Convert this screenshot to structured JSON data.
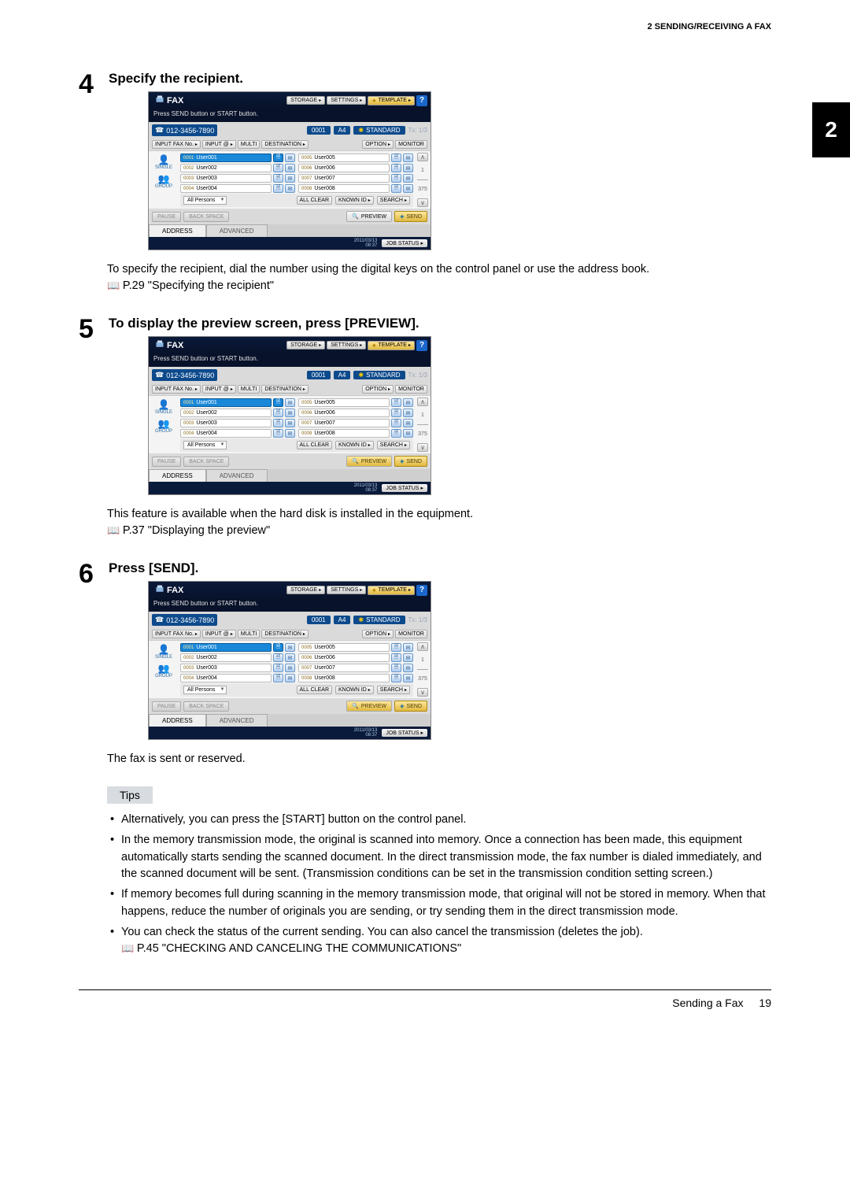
{
  "header": {
    "section": "2 SENDING/RECEIVING A FAX"
  },
  "chapter_tab": "2",
  "steps": {
    "s4": {
      "num": "4",
      "title": "Specify the recipient.",
      "body": "To specify the recipient, dial the number using the digital keys on the control panel or use the address book.",
      "ref": "P.29 \"Specifying the recipient\""
    },
    "s5": {
      "num": "5",
      "title": "To display the preview screen, press [PREVIEW].",
      "body": "This feature is available when the hard disk is installed in the equipment.",
      "ref": "P.37 \"Displaying the preview\""
    },
    "s6": {
      "num": "6",
      "title": "Press [SEND].",
      "body": "The fax is sent or reserved."
    }
  },
  "fax_panel": {
    "title": "FAX",
    "topbar": {
      "storage": "STORAGE",
      "settings": "SETTINGS",
      "template": "TEMPLATE",
      "help": "?"
    },
    "instruction": "Press SEND button or START button.",
    "status": {
      "fax_number": "012-3456-7890",
      "counter": "0001",
      "paper": "A4",
      "mode": "STANDARD",
      "tx_faded": "Tx: 1/3"
    },
    "row2": {
      "input_fax": "INPUT FAX No.",
      "input_at": "INPUT @",
      "multi": "MULTI",
      "destination": "DESTINATION",
      "option": "OPTION",
      "monitor": "MONITOR"
    },
    "sidebar": {
      "single": "SINGLE",
      "group": "GROUP"
    },
    "contacts_left": [
      {
        "id": "0001",
        "name": "User001"
      },
      {
        "id": "0002",
        "name": "User002"
      },
      {
        "id": "0003",
        "name": "User003"
      },
      {
        "id": "0004",
        "name": "User004"
      }
    ],
    "contacts_right": [
      {
        "id": "0005",
        "name": "User005"
      },
      {
        "id": "0006",
        "name": "User006"
      },
      {
        "id": "0007",
        "name": "User007"
      },
      {
        "id": "0008",
        "name": "User008"
      }
    ],
    "scroll": {
      "page": "1",
      "total": "375"
    },
    "filter": {
      "dropdown": "All Persons",
      "all_clear": "ALL CLEAR",
      "known_id": "KNOWN ID",
      "search": "SEARCH"
    },
    "bottom": {
      "pause": "PAUSE",
      "backspace": "BACK SPACE",
      "preview": "PREVIEW",
      "send": "SEND"
    },
    "tabs": {
      "address": "ADDRESS",
      "advanced": "ADVANCED"
    },
    "footer": {
      "ts1": "2011/03/13",
      "ts2": "08:37",
      "job_status": "JOB STATUS"
    }
  },
  "tips": {
    "label": "Tips",
    "items": [
      "Alternatively, you can press the [START] button on the control panel.",
      "In the memory transmission mode, the original is scanned into memory. Once a connection has been made, this equipment automatically starts sending the scanned document. In the direct transmission mode, the fax number is dialed immediately, and the scanned document will be sent. (Transmission conditions can be set in the transmission condition setting screen.)",
      "If memory becomes full during scanning in the memory transmission mode, that original will not be stored in memory. When that happens, reduce the number of originals you are sending, or try sending them in the direct transmission mode.",
      "You can check the status of the current sending. You can also cancel the transmission (deletes the job)."
    ],
    "ref": "P.45 \"CHECKING AND CANCELING THE COMMUNICATIONS\""
  },
  "footer": {
    "title": "Sending a Fax",
    "page": "19"
  }
}
